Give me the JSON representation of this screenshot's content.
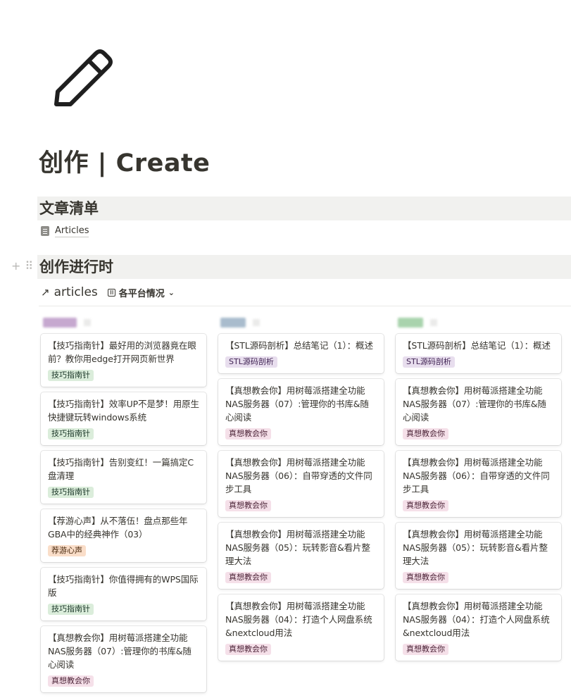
{
  "page": {
    "icon": "pencil-icon",
    "title": "创作 | Create"
  },
  "sections": {
    "article_list": {
      "heading": "文章清单",
      "link": {
        "icon": "document-icon",
        "label": "Articles"
      }
    },
    "in_progress": {
      "heading": "创作进行时",
      "gutter": {
        "add": "+",
        "drag": "⠿"
      }
    }
  },
  "database": {
    "arrow": "↗",
    "title": "articles",
    "view_icon": "board-icon",
    "view_label": "各平台情况",
    "view_chevron": "⌄"
  },
  "groups": [
    {
      "name_hidden": true,
      "swatch_color": "#c6a8cf"
    },
    {
      "name_hidden": true,
      "swatch_color": "#a9bccd"
    },
    {
      "name_hidden": true,
      "swatch_color": "#a9d3ad"
    }
  ],
  "tag_colors": {
    "技巧指南针": {
      "bg": "#dbeddb",
      "fg": "#1c3829"
    },
    "STL源码剖析": {
      "bg": "#e8deee",
      "fg": "#412454"
    },
    "真想教会你": {
      "bg": "#f5e0e9",
      "fg": "#4c2337"
    },
    "荐游心声": {
      "bg": "#fadec9",
      "fg": "#49290e"
    }
  },
  "columns": [
    {
      "cards": [
        {
          "title": "【技巧指南针】最好用的浏览器竟在眼前？教你用edge打开网页新世界",
          "tag": "技巧指南针"
        },
        {
          "title": "【技巧指南针】效率UP不是梦！用原生快捷键玩转windows系统",
          "tag": "技巧指南针"
        },
        {
          "title": "【技巧指南针】告别变红！一篇搞定C盘清理",
          "tag": "技巧指南针"
        },
        {
          "title": "【荐游心声】从不落伍！盘点那些年GBA中的经典神作（03）",
          "tag": "荐游心声"
        },
        {
          "title": "【技巧指南针】你值得拥有的WPS国际版",
          "tag": "技巧指南针"
        },
        {
          "title": "【真想教会你】用树莓派搭建全功能NAS服务器（07）:管理你的书库&随心阅读",
          "tag": "真想教会你"
        }
      ]
    },
    {
      "cards": [
        {
          "title": "【STL源码剖析】总结笔记（1）：概述",
          "tag": "STL源码剖析"
        },
        {
          "title": "【真想教会你】用树莓派搭建全功能NAS服务器（07）:管理你的书库&随心阅读",
          "tag": "真想教会你"
        },
        {
          "title": "【真想教会你】用树莓派搭建全功能NAS服务器（06）：自带穿透的文件同步工具",
          "tag": "真想教会你"
        },
        {
          "title": "【真想教会你】用树莓派搭建全功能NAS服务器（05）：玩转影音&看片整理大法",
          "tag": "真想教会你"
        },
        {
          "title": "【真想教会你】用树莓派搭建全功能NAS服务器（04）：打造个人网盘系统&nextcloud用法",
          "tag": "真想教会你"
        }
      ]
    },
    {
      "cards": [
        {
          "title": "【STL源码剖析】总结笔记（1）：概述",
          "tag": "STL源码剖析"
        },
        {
          "title": "【真想教会你】用树莓派搭建全功能NAS服务器（07）:管理你的书库&随心阅读",
          "tag": "真想教会你"
        },
        {
          "title": "【真想教会你】用树莓派搭建全功能NAS服务器（06）：自带穿透的文件同步工具",
          "tag": "真想教会你"
        },
        {
          "title": "【真想教会你】用树莓派搭建全功能NAS服务器（05）：玩转影音&看片整理大法",
          "tag": "真想教会你"
        },
        {
          "title": "【真想教会你】用树莓派搭建全功能NAS服务器（04）：打造个人网盘系统&nextcloud用法",
          "tag": "真想教会你"
        }
      ]
    }
  ]
}
